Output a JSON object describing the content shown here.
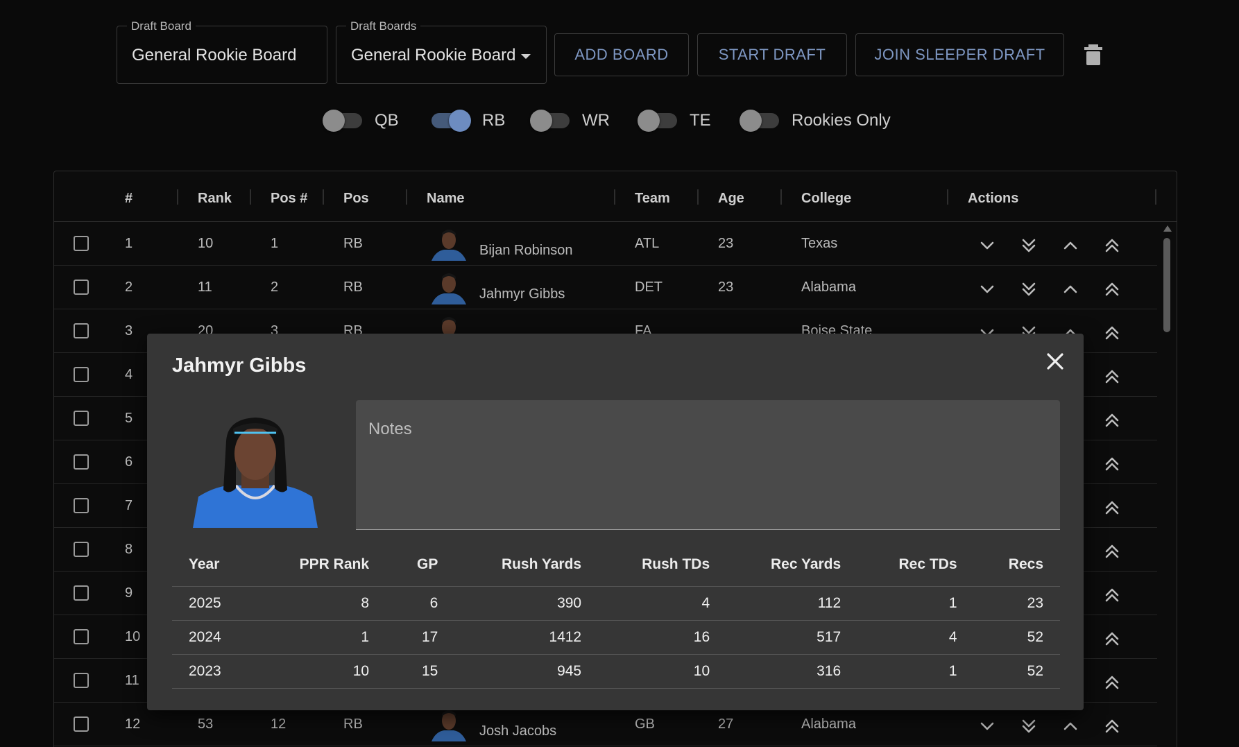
{
  "controls": {
    "board_name": {
      "label": "Draft Board",
      "value": "General Rookie Board"
    },
    "boards_select": {
      "label": "Draft Boards",
      "value": "General Rookie Board"
    },
    "add_board": "ADD BOARD",
    "start_draft": "START DRAFT",
    "join_sleeper": "JOIN SLEEPER DRAFT"
  },
  "filters": [
    {
      "label": "QB",
      "on": false
    },
    {
      "label": "RB",
      "on": true
    },
    {
      "label": "WR",
      "on": false
    },
    {
      "label": "TE",
      "on": false
    },
    {
      "label": "Rookies Only",
      "on": false
    }
  ],
  "table": {
    "headers": [
      "#",
      "Rank",
      "Pos #",
      "Pos",
      "Name",
      "Team",
      "Age",
      "College",
      "Actions"
    ],
    "rows": [
      {
        "num": "1",
        "rank": "10",
        "pos_num": "1",
        "pos": "RB",
        "name": "Bijan Robinson",
        "team": "ATL",
        "age": "23",
        "college": "Texas"
      },
      {
        "num": "2",
        "rank": "11",
        "pos_num": "2",
        "pos": "RB",
        "name": "Jahmyr Gibbs",
        "team": "DET",
        "age": "23",
        "college": "Alabama"
      },
      {
        "num": "3",
        "rank": "20",
        "pos_num": "3",
        "pos": "RB",
        "name": "",
        "team": "FA",
        "age": "",
        "college": "Boise State"
      },
      {
        "num": "4"
      },
      {
        "num": "5"
      },
      {
        "num": "6"
      },
      {
        "num": "7"
      },
      {
        "num": "8"
      },
      {
        "num": "9"
      },
      {
        "num": "10"
      },
      {
        "num": "11"
      },
      {
        "num": "12",
        "rank": "53",
        "pos_num": "12",
        "pos": "RB",
        "name": "Josh Jacobs",
        "team": "GB",
        "age": "27",
        "college": "Alabama"
      }
    ]
  },
  "modal": {
    "title": "Jahmyr Gibbs",
    "notes_label": "Notes",
    "stats_headers": [
      "Year",
      "PPR Rank",
      "GP",
      "Rush Yards",
      "Rush TDs",
      "Rec Yards",
      "Rec TDs",
      "Recs"
    ],
    "stats_rows": [
      [
        "2025",
        "8",
        "6",
        "390",
        "4",
        "112",
        "1",
        "23"
      ],
      [
        "2024",
        "1",
        "17",
        "1412",
        "16",
        "517",
        "4",
        "52"
      ],
      [
        "2023",
        "10",
        "15",
        "945",
        "10",
        "316",
        "1",
        "52"
      ]
    ]
  }
}
